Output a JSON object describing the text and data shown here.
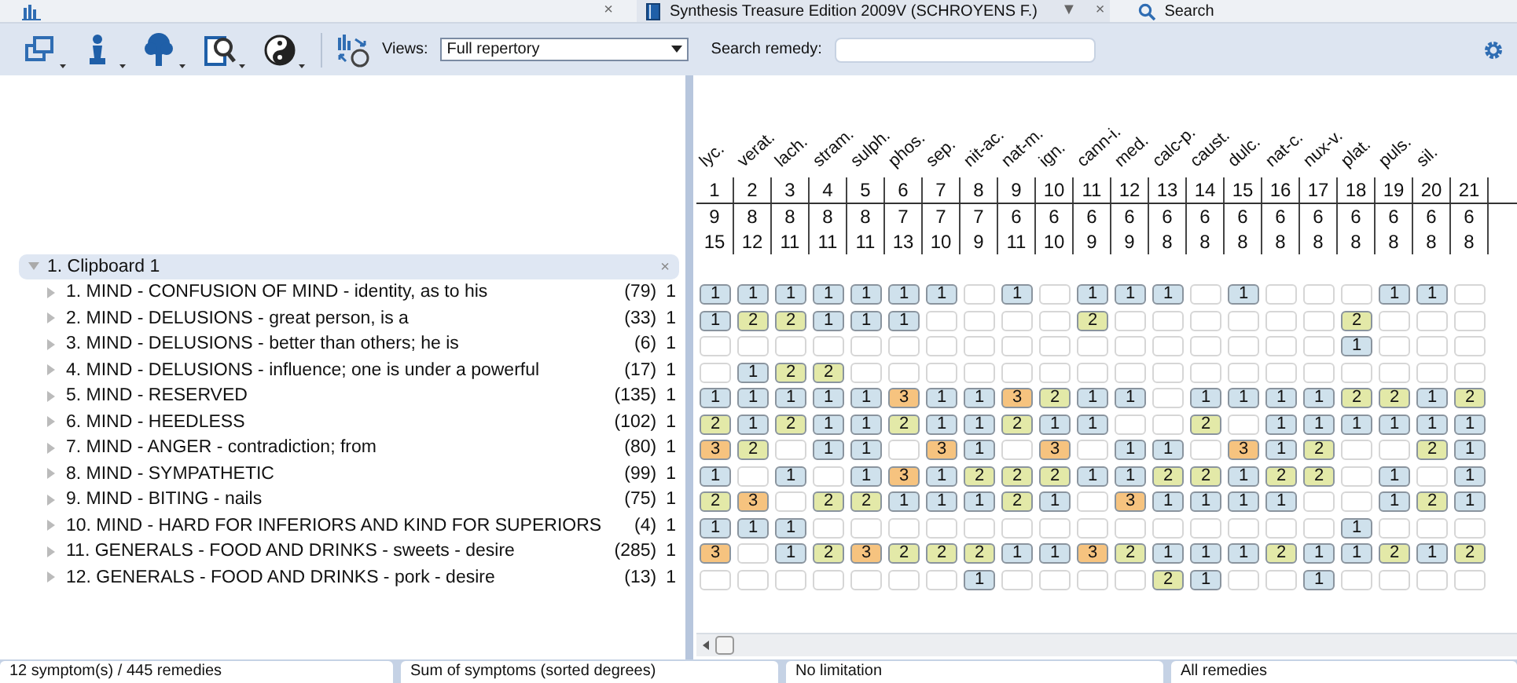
{
  "title_bar": {
    "tab_close": "×",
    "tab_title": "Synthesis Treasure Edition 2009V (SCHROYENS F.)",
    "menu_caret": "▼",
    "close": "×",
    "search_label": "Search"
  },
  "toolbar": {
    "views_label": "Views:",
    "views_value": "Full repertory",
    "search_label": "Search remedy:"
  },
  "clipboard": {
    "title": "1. Clipboard 1",
    "expanded": true,
    "close": "×",
    "symptoms": [
      {
        "text": "1. MIND - CONFUSION OF MIND - identity, as to his",
        "count": "(79)",
        "weight": "1"
      },
      {
        "text": "2. MIND - DELUSIONS - great person, is a",
        "count": "(33)",
        "weight": "1"
      },
      {
        "text": "3. MIND - DELUSIONS - better than others; he is",
        "count": "(6)",
        "weight": "1"
      },
      {
        "text": "4. MIND - DELUSIONS - influence; one is under a powerful",
        "count": "(17)",
        "weight": "1"
      },
      {
        "text": "5. MIND - RESERVED",
        "count": "(135)",
        "weight": "1"
      },
      {
        "text": "6. MIND - HEEDLESS",
        "count": "(102)",
        "weight": "1"
      },
      {
        "text": "7. MIND - ANGER - contradiction; from",
        "count": "(80)",
        "weight": "1"
      },
      {
        "text": "8. MIND - SYMPATHETIC",
        "count": "(99)",
        "weight": "1"
      },
      {
        "text": "9. MIND - BITING - nails",
        "count": "(75)",
        "weight": "1"
      },
      {
        "text": "10. MIND - HARD FOR INFERIORS AND KIND FOR SUPERIORS",
        "count": "(4)",
        "weight": "1"
      },
      {
        "text": "11. GENERALS - FOOD AND DRINKS - sweets - desire",
        "count": "(285)",
        "weight": "1"
      },
      {
        "text": "12. GENERALS - FOOD AND DRINKS - pork - desire",
        "count": "(13)",
        "weight": "1"
      }
    ]
  },
  "remedies": [
    {
      "name": "lyc.",
      "number": "1",
      "symptom_count": "9",
      "degree_sum": "15"
    },
    {
      "name": "verat.",
      "number": "2",
      "symptom_count": "8",
      "degree_sum": "12"
    },
    {
      "name": "lach.",
      "number": "3",
      "symptom_count": "8",
      "degree_sum": "11"
    },
    {
      "name": "stram.",
      "number": "4",
      "symptom_count": "8",
      "degree_sum": "11"
    },
    {
      "name": "sulph.",
      "number": "5",
      "symptom_count": "8",
      "degree_sum": "11"
    },
    {
      "name": "phos.",
      "number": "6",
      "symptom_count": "7",
      "degree_sum": "13"
    },
    {
      "name": "sep.",
      "number": "7",
      "symptom_count": "7",
      "degree_sum": "10"
    },
    {
      "name": "nit-ac.",
      "number": "8",
      "symptom_count": "7",
      "degree_sum": "9"
    },
    {
      "name": "nat-m.",
      "number": "9",
      "symptom_count": "6",
      "degree_sum": "11"
    },
    {
      "name": "ign.",
      "number": "10",
      "symptom_count": "6",
      "degree_sum": "10"
    },
    {
      "name": "cann-i.",
      "number": "11",
      "symptom_count": "6",
      "degree_sum": "9"
    },
    {
      "name": "med.",
      "number": "12",
      "symptom_count": "6",
      "degree_sum": "9"
    },
    {
      "name": "calc-p.",
      "number": "13",
      "symptom_count": "6",
      "degree_sum": "8"
    },
    {
      "name": "caust.",
      "number": "14",
      "symptom_count": "6",
      "degree_sum": "8"
    },
    {
      "name": "dulc.",
      "number": "15",
      "symptom_count": "6",
      "degree_sum": "8"
    },
    {
      "name": "nat-c.",
      "number": "16",
      "symptom_count": "6",
      "degree_sum": "8"
    },
    {
      "name": "nux-v.",
      "number": "17",
      "symptom_count": "6",
      "degree_sum": "8"
    },
    {
      "name": "plat.",
      "number": "18",
      "symptom_count": "6",
      "degree_sum": "8"
    },
    {
      "name": "puls.",
      "number": "19",
      "symptom_count": "6",
      "degree_sum": "8"
    },
    {
      "name": "sil.",
      "number": "20",
      "symptom_count": "6",
      "degree_sum": "8"
    },
    {
      "number": "21",
      "symptom_count": "6",
      "degree_sum": "8"
    }
  ],
  "rows": [
    {
      "cells": [
        {
          "kind": "grade",
          "value": "1",
          "color": "#cfe1ec"
        },
        {
          "kind": "grade",
          "value": "1",
          "color": "#cfe1ec"
        },
        {
          "kind": "grade",
          "value": "1",
          "color": "#cfe1ec"
        },
        {
          "kind": "grade",
          "value": "1",
          "color": "#cfe1ec"
        },
        {
          "kind": "grade",
          "value": "1",
          "color": "#cfe1ec"
        },
        {
          "kind": "grade",
          "value": "1",
          "color": "#cfe1ec"
        },
        {
          "kind": "grade",
          "value": "1",
          "color": "#cfe1ec"
        },
        {
          "kind": "empty"
        },
        {
          "kind": "grade",
          "value": "1",
          "color": "#cfe1ec"
        },
        {
          "kind": "empty"
        },
        {
          "kind": "grade",
          "value": "1",
          "color": "#cfe1ec"
        },
        {
          "kind": "grade",
          "value": "1",
          "color": "#cfe1ec"
        },
        {
          "kind": "grade",
          "value": "1",
          "color": "#cfe1ec"
        },
        {
          "kind": "empty"
        },
        {
          "kind": "grade",
          "value": "1",
          "color": "#cfe1ec"
        },
        {
          "kind": "empty"
        },
        {
          "kind": "empty"
        },
        {
          "kind": "empty"
        },
        {
          "kind": "grade",
          "value": "1",
          "color": "#cfe1ec"
        },
        {
          "kind": "grade",
          "value": "1",
          "color": "#cfe1ec"
        },
        {
          "kind": "empty"
        }
      ]
    },
    {
      "cells": [
        {
          "kind": "grade",
          "value": "1",
          "color": "#cfe1ec"
        },
        {
          "kind": "grade",
          "value": "2",
          "color": "#e3e9a8"
        },
        {
          "kind": "grade",
          "value": "2",
          "color": "#e3e9a8"
        },
        {
          "kind": "grade",
          "value": "1",
          "color": "#cfe1ec"
        },
        {
          "kind": "grade",
          "value": "1",
          "color": "#cfe1ec"
        },
        {
          "kind": "grade",
          "value": "1",
          "color": "#cfe1ec"
        },
        {
          "kind": "empty"
        },
        {
          "kind": "empty"
        },
        {
          "kind": "empty"
        },
        {
          "kind": "empty"
        },
        {
          "kind": "grade",
          "value": "2",
          "color": "#e3e9a8"
        },
        {
          "kind": "empty"
        },
        {
          "kind": "empty"
        },
        {
          "kind": "empty"
        },
        {
          "kind": "empty"
        },
        {
          "kind": "empty"
        },
        {
          "kind": "empty"
        },
        {
          "kind": "grade",
          "value": "2",
          "color": "#e3e9a8"
        },
        {
          "kind": "empty"
        },
        {
          "kind": "empty"
        },
        {
          "kind": "empty"
        }
      ]
    },
    {
      "cells": [
        {
          "kind": "empty"
        },
        {
          "kind": "empty"
        },
        {
          "kind": "empty"
        },
        {
          "kind": "empty"
        },
        {
          "kind": "empty"
        },
        {
          "kind": "empty"
        },
        {
          "kind": "empty"
        },
        {
          "kind": "empty"
        },
        {
          "kind": "empty"
        },
        {
          "kind": "empty"
        },
        {
          "kind": "empty"
        },
        {
          "kind": "empty"
        },
        {
          "kind": "empty"
        },
        {
          "kind": "empty"
        },
        {
          "kind": "empty"
        },
        {
          "kind": "empty"
        },
        {
          "kind": "empty"
        },
        {
          "kind": "grade",
          "value": "1",
          "color": "#cfe1ec"
        },
        {
          "kind": "empty"
        },
        {
          "kind": "empty"
        },
        {
          "kind": "empty"
        }
      ]
    },
    {
      "cells": [
        {
          "kind": "empty"
        },
        {
          "kind": "grade",
          "value": "1",
          "color": "#cfe1ec"
        },
        {
          "kind": "grade",
          "value": "2",
          "color": "#e3e9a8"
        },
        {
          "kind": "grade",
          "value": "2",
          "color": "#e3e9a8"
        },
        {
          "kind": "empty"
        },
        {
          "kind": "empty"
        },
        {
          "kind": "empty"
        },
        {
          "kind": "empty"
        },
        {
          "kind": "empty"
        },
        {
          "kind": "empty"
        },
        {
          "kind": "empty"
        },
        {
          "kind": "empty"
        },
        {
          "kind": "empty"
        },
        {
          "kind": "empty"
        },
        {
          "kind": "empty"
        },
        {
          "kind": "empty"
        },
        {
          "kind": "empty"
        },
        {
          "kind": "empty"
        },
        {
          "kind": "empty"
        },
        {
          "kind": "empty"
        },
        {
          "kind": "empty"
        }
      ]
    },
    {
      "cells": [
        {
          "kind": "grade",
          "value": "1",
          "color": "#cfe1ec"
        },
        {
          "kind": "grade",
          "value": "1",
          "color": "#cfe1ec"
        },
        {
          "kind": "grade",
          "value": "1",
          "color": "#cfe1ec"
        },
        {
          "kind": "grade",
          "value": "1",
          "color": "#cfe1ec"
        },
        {
          "kind": "grade",
          "value": "1",
          "color": "#cfe1ec"
        },
        {
          "kind": "grade",
          "value": "3",
          "color": "#f6c37f"
        },
        {
          "kind": "grade",
          "value": "1",
          "color": "#cfe1ec"
        },
        {
          "kind": "grade",
          "value": "1",
          "color": "#cfe1ec"
        },
        {
          "kind": "grade",
          "value": "3",
          "color": "#f6c37f"
        },
        {
          "kind": "grade",
          "value": "2",
          "color": "#e3e9a8"
        },
        {
          "kind": "grade",
          "value": "1",
          "color": "#cfe1ec"
        },
        {
          "kind": "grade",
          "value": "1",
          "color": "#cfe1ec"
        },
        {
          "kind": "empty"
        },
        {
          "kind": "grade",
          "value": "1",
          "color": "#cfe1ec"
        },
        {
          "kind": "grade",
          "value": "1",
          "color": "#cfe1ec"
        },
        {
          "kind": "grade",
          "value": "1",
          "color": "#cfe1ec"
        },
        {
          "kind": "grade",
          "value": "1",
          "color": "#cfe1ec"
        },
        {
          "kind": "grade",
          "value": "2",
          "color": "#e3e9a8"
        },
        {
          "kind": "grade",
          "value": "2",
          "color": "#e3e9a8"
        },
        {
          "kind": "grade",
          "value": "1",
          "color": "#cfe1ec"
        },
        {
          "kind": "grade",
          "value": "2",
          "color": "#e3e9a8"
        }
      ]
    },
    {
      "cells": [
        {
          "kind": "grade",
          "value": "2",
          "color": "#e3e9a8"
        },
        {
          "kind": "grade",
          "value": "1",
          "color": "#cfe1ec"
        },
        {
          "kind": "grade",
          "value": "2",
          "color": "#e3e9a8"
        },
        {
          "kind": "grade",
          "value": "1",
          "color": "#cfe1ec"
        },
        {
          "kind": "grade",
          "value": "1",
          "color": "#cfe1ec"
        },
        {
          "kind": "grade",
          "value": "2",
          "color": "#e3e9a8"
        },
        {
          "kind": "grade",
          "value": "1",
          "color": "#cfe1ec"
        },
        {
          "kind": "grade",
          "value": "1",
          "color": "#cfe1ec"
        },
        {
          "kind": "grade",
          "value": "2",
          "color": "#e3e9a8"
        },
        {
          "kind": "grade",
          "value": "1",
          "color": "#cfe1ec"
        },
        {
          "kind": "grade",
          "value": "1",
          "color": "#cfe1ec"
        },
        {
          "kind": "empty"
        },
        {
          "kind": "empty"
        },
        {
          "kind": "grade",
          "value": "2",
          "color": "#e3e9a8"
        },
        {
          "kind": "empty"
        },
        {
          "kind": "grade",
          "value": "1",
          "color": "#cfe1ec"
        },
        {
          "kind": "grade",
          "value": "1",
          "color": "#cfe1ec"
        },
        {
          "kind": "grade",
          "value": "1",
          "color": "#cfe1ec"
        },
        {
          "kind": "grade",
          "value": "1",
          "color": "#cfe1ec"
        },
        {
          "kind": "grade",
          "value": "1",
          "color": "#cfe1ec"
        },
        {
          "kind": "grade",
          "value": "1",
          "color": "#cfe1ec"
        }
      ]
    },
    {
      "cells": [
        {
          "kind": "grade",
          "value": "3",
          "color": "#f6c37f"
        },
        {
          "kind": "grade",
          "value": "2",
          "color": "#e3e9a8"
        },
        {
          "kind": "empty"
        },
        {
          "kind": "grade",
          "value": "1",
          "color": "#cfe1ec"
        },
        {
          "kind": "grade",
          "value": "1",
          "color": "#cfe1ec"
        },
        {
          "kind": "empty"
        },
        {
          "kind": "grade",
          "value": "3",
          "color": "#f6c37f"
        },
        {
          "kind": "grade",
          "value": "1",
          "color": "#cfe1ec"
        },
        {
          "kind": "empty"
        },
        {
          "kind": "grade",
          "value": "3",
          "color": "#f6c37f"
        },
        {
          "kind": "empty"
        },
        {
          "kind": "grade",
          "value": "1",
          "color": "#cfe1ec"
        },
        {
          "kind": "grade",
          "value": "1",
          "color": "#cfe1ec"
        },
        {
          "kind": "empty"
        },
        {
          "kind": "grade",
          "value": "3",
          "color": "#f6c37f"
        },
        {
          "kind": "grade",
          "value": "1",
          "color": "#cfe1ec"
        },
        {
          "kind": "grade",
          "value": "2",
          "color": "#e3e9a8"
        },
        {
          "kind": "empty"
        },
        {
          "kind": "empty"
        },
        {
          "kind": "grade",
          "value": "2",
          "color": "#e3e9a8"
        },
        {
          "kind": "grade",
          "value": "1",
          "color": "#cfe1ec"
        }
      ]
    },
    {
      "cells": [
        {
          "kind": "grade",
          "value": "1",
          "color": "#cfe1ec"
        },
        {
          "kind": "empty"
        },
        {
          "kind": "grade",
          "value": "1",
          "color": "#cfe1ec"
        },
        {
          "kind": "empty"
        },
        {
          "kind": "grade",
          "value": "1",
          "color": "#cfe1ec"
        },
        {
          "kind": "grade",
          "value": "3",
          "color": "#f6c37f"
        },
        {
          "kind": "grade",
          "value": "1",
          "color": "#cfe1ec"
        },
        {
          "kind": "grade",
          "value": "2",
          "color": "#e3e9a8"
        },
        {
          "kind": "grade",
          "value": "2",
          "color": "#e3e9a8"
        },
        {
          "kind": "grade",
          "value": "2",
          "color": "#e3e9a8"
        },
        {
          "kind": "grade",
          "value": "1",
          "color": "#cfe1ec"
        },
        {
          "kind": "grade",
          "value": "1",
          "color": "#cfe1ec"
        },
        {
          "kind": "grade",
          "value": "2",
          "color": "#e3e9a8"
        },
        {
          "kind": "grade",
          "value": "2",
          "color": "#e3e9a8"
        },
        {
          "kind": "grade",
          "value": "1",
          "color": "#cfe1ec"
        },
        {
          "kind": "grade",
          "value": "2",
          "color": "#e3e9a8"
        },
        {
          "kind": "grade",
          "value": "2",
          "color": "#e3e9a8"
        },
        {
          "kind": "empty"
        },
        {
          "kind": "grade",
          "value": "1",
          "color": "#cfe1ec"
        },
        {
          "kind": "empty"
        },
        {
          "kind": "grade",
          "value": "1",
          "color": "#cfe1ec"
        }
      ]
    },
    {
      "cells": [
        {
          "kind": "grade",
          "value": "2",
          "color": "#e3e9a8"
        },
        {
          "kind": "grade",
          "value": "3",
          "color": "#f6c37f"
        },
        {
          "kind": "empty"
        },
        {
          "kind": "grade",
          "value": "2",
          "color": "#e3e9a8"
        },
        {
          "kind": "grade",
          "value": "2",
          "color": "#e3e9a8"
        },
        {
          "kind": "grade",
          "value": "1",
          "color": "#cfe1ec"
        },
        {
          "kind": "grade",
          "value": "1",
          "color": "#cfe1ec"
        },
        {
          "kind": "grade",
          "value": "1",
          "color": "#cfe1ec"
        },
        {
          "kind": "grade",
          "value": "2",
          "color": "#e3e9a8"
        },
        {
          "kind": "grade",
          "value": "1",
          "color": "#cfe1ec"
        },
        {
          "kind": "empty"
        },
        {
          "kind": "grade",
          "value": "3",
          "color": "#f6c37f"
        },
        {
          "kind": "grade",
          "value": "1",
          "color": "#cfe1ec"
        },
        {
          "kind": "grade",
          "value": "1",
          "color": "#cfe1ec"
        },
        {
          "kind": "grade",
          "value": "1",
          "color": "#cfe1ec"
        },
        {
          "kind": "grade",
          "value": "1",
          "color": "#cfe1ec"
        },
        {
          "kind": "empty"
        },
        {
          "kind": "empty"
        },
        {
          "kind": "grade",
          "value": "1",
          "color": "#cfe1ec"
        },
        {
          "kind": "grade",
          "value": "2",
          "color": "#e3e9a8"
        },
        {
          "kind": "grade",
          "value": "1",
          "color": "#cfe1ec"
        }
      ]
    },
    {
      "cells": [
        {
          "kind": "grade",
          "value": "1",
          "color": "#cfe1ec"
        },
        {
          "kind": "grade",
          "value": "1",
          "color": "#cfe1ec"
        },
        {
          "kind": "grade",
          "value": "1",
          "color": "#cfe1ec"
        },
        {
          "kind": "empty"
        },
        {
          "kind": "empty"
        },
        {
          "kind": "empty"
        },
        {
          "kind": "empty"
        },
        {
          "kind": "empty"
        },
        {
          "kind": "empty"
        },
        {
          "kind": "empty"
        },
        {
          "kind": "empty"
        },
        {
          "kind": "empty"
        },
        {
          "kind": "empty"
        },
        {
          "kind": "empty"
        },
        {
          "kind": "empty"
        },
        {
          "kind": "empty"
        },
        {
          "kind": "empty"
        },
        {
          "kind": "grade",
          "value": "1",
          "color": "#cfe1ec"
        },
        {
          "kind": "empty"
        },
        {
          "kind": "empty"
        },
        {
          "kind": "empty"
        }
      ]
    },
    {
      "cells": [
        {
          "kind": "grade",
          "value": "3",
          "color": "#f6c37f"
        },
        {
          "kind": "empty"
        },
        {
          "kind": "grade",
          "value": "1",
          "color": "#cfe1ec"
        },
        {
          "kind": "grade",
          "value": "2",
          "color": "#e3e9a8"
        },
        {
          "kind": "grade",
          "value": "3",
          "color": "#f6c37f"
        },
        {
          "kind": "grade",
          "value": "2",
          "color": "#e3e9a8"
        },
        {
          "kind": "grade",
          "value": "2",
          "color": "#e3e9a8"
        },
        {
          "kind": "grade",
          "value": "2",
          "color": "#e3e9a8"
        },
        {
          "kind": "grade",
          "value": "1",
          "color": "#cfe1ec"
        },
        {
          "kind": "grade",
          "value": "1",
          "color": "#cfe1ec"
        },
        {
          "kind": "grade",
          "value": "3",
          "color": "#f6c37f"
        },
        {
          "kind": "grade",
          "value": "2",
          "color": "#e3e9a8"
        },
        {
          "kind": "grade",
          "value": "1",
          "color": "#cfe1ec"
        },
        {
          "kind": "grade",
          "value": "1",
          "color": "#cfe1ec"
        },
        {
          "kind": "grade",
          "value": "1",
          "color": "#cfe1ec"
        },
        {
          "kind": "grade",
          "value": "2",
          "color": "#e3e9a8"
        },
        {
          "kind": "grade",
          "value": "1",
          "color": "#cfe1ec"
        },
        {
          "kind": "grade",
          "value": "1",
          "color": "#cfe1ec"
        },
        {
          "kind": "grade",
          "value": "2",
          "color": "#e3e9a8"
        },
        {
          "kind": "grade",
          "value": "1",
          "color": "#cfe1ec"
        },
        {
          "kind": "grade",
          "value": "2",
          "color": "#e3e9a8"
        }
      ]
    },
    {
      "cells": [
        {
          "kind": "empty"
        },
        {
          "kind": "empty"
        },
        {
          "kind": "empty"
        },
        {
          "kind": "empty"
        },
        {
          "kind": "empty"
        },
        {
          "kind": "empty"
        },
        {
          "kind": "empty"
        },
        {
          "kind": "grade",
          "value": "1",
          "color": "#cfe1ec"
        },
        {
          "kind": "empty"
        },
        {
          "kind": "empty"
        },
        {
          "kind": "empty"
        },
        {
          "kind": "empty"
        },
        {
          "kind": "grade",
          "value": "2",
          "color": "#e3e9a8"
        },
        {
          "kind": "grade",
          "value": "1",
          "color": "#cfe1ec"
        },
        {
          "kind": "empty"
        },
        {
          "kind": "empty"
        },
        {
          "kind": "grade",
          "value": "1",
          "color": "#cfe1ec"
        },
        {
          "kind": "empty"
        },
        {
          "kind": "empty"
        },
        {
          "kind": "empty"
        },
        {
          "kind": "empty"
        }
      ]
    }
  ],
  "status_bar": [
    "12 symptom(s) / 445 remedies",
    "Sum of symptoms (sorted degrees)",
    "No limitation",
    "All remedies"
  ]
}
